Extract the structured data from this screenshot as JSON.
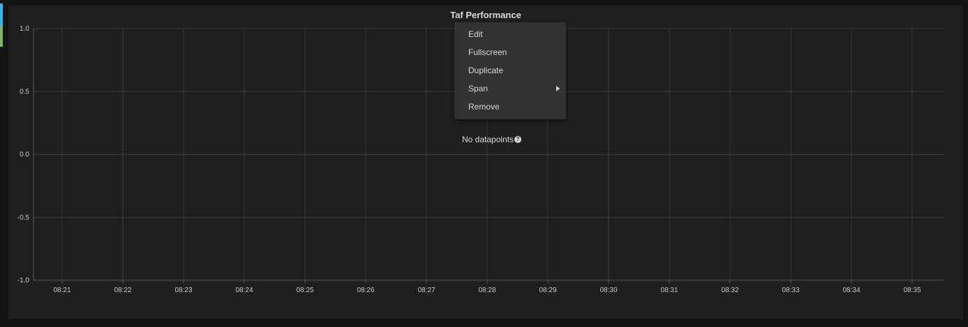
{
  "row_accent": {
    "top_color": "#33b5e5",
    "bottom_color": "#7eb26d"
  },
  "panel": {
    "title": "Taf Performance",
    "no_data_text": "No datapoints",
    "help_icon": "question-circle-icon"
  },
  "context_menu": {
    "items": [
      {
        "label": "Edit",
        "has_submenu": false
      },
      {
        "label": "Fullscreen",
        "has_submenu": false
      },
      {
        "label": "Duplicate",
        "has_submenu": false
      },
      {
        "label": "Span",
        "has_submenu": true
      },
      {
        "label": "Remove",
        "has_submenu": false
      }
    ]
  },
  "chart_data": {
    "type": "line",
    "title": "Taf Performance",
    "series": [],
    "x_ticks": [
      "08:21",
      "08:22",
      "08:23",
      "08:24",
      "08:25",
      "08:26",
      "08:27",
      "08:28",
      "08:29",
      "08:30",
      "08:31",
      "08:32",
      "08:33",
      "08:34",
      "08:35"
    ],
    "y_ticks": [
      "1.0",
      "0.5",
      "0.0",
      "-0.5",
      "-1.0"
    ],
    "ylim": [
      -1.0,
      1.0
    ],
    "grid": true,
    "colors": {
      "grid": "#3a3a3a",
      "axis": "#555555",
      "text": "#c8c8c8"
    }
  }
}
